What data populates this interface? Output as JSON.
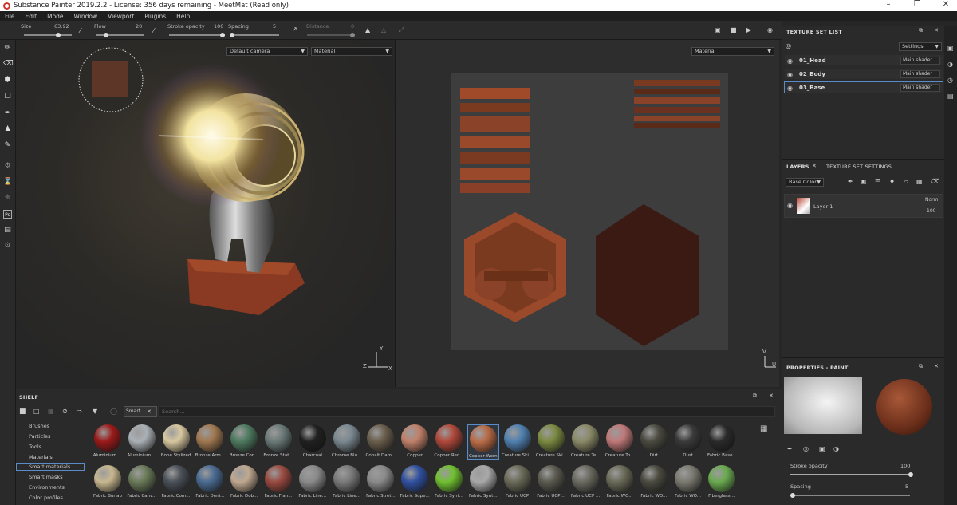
{
  "window": {
    "title": "Substance Painter 2019.2.2 - License: 356 days remaining - MeetMat (Read only)"
  },
  "menu": [
    "File",
    "Edit",
    "Mode",
    "Window",
    "Viewport",
    "Plugins",
    "Help"
  ],
  "toolbar": {
    "size_label": "Size",
    "size_value": "63.92",
    "flow_label": "Flow",
    "flow_value": "20",
    "opacity_label": "Stroke opacity",
    "opacity_value": "100",
    "spacing_label": "Spacing",
    "spacing_value": "5",
    "distance_label": "Distance",
    "distance_value": "0"
  },
  "viewport": {
    "camera": "Default camera",
    "mode3d": "Material",
    "mode2d": "Material"
  },
  "axes": {
    "y": "Y",
    "z": "Z",
    "x": "X",
    "v": "V",
    "u": "U"
  },
  "texture_set_list": {
    "title": "TEXTURE SET LIST",
    "settings": "Settings",
    "items": [
      {
        "name": "01_Head",
        "shader": "Main shader"
      },
      {
        "name": "02_Body",
        "shader": "Main shader"
      },
      {
        "name": "03_Base",
        "shader": "Main shader"
      }
    ]
  },
  "layers": {
    "tab_layers": "LAYERS",
    "tab_settings": "TEXTURE SET SETTINGS",
    "channel": "Base Color",
    "layer_name": "Layer 1",
    "blend": "Norm",
    "opacity": "100"
  },
  "properties": {
    "title": "PROPERTIES - PAINT",
    "opacity_label": "Stroke opacity",
    "opacity_value": "100",
    "spacing_label": "Spacing",
    "spacing_value": "5"
  },
  "shelf": {
    "title": "SHELF",
    "filter_tag": "Smart...",
    "search_placeholder": "Search...",
    "nav": [
      "Brushes",
      "Particles",
      "Tools",
      "Materials",
      "Smart materials",
      "Smart masks",
      "Environments",
      "Color profiles"
    ],
    "selected_nav": "Smart materials",
    "row1": [
      "Aluminium ...",
      "Aluminium ...",
      "Bone Stylized",
      "Bronze Arm...",
      "Bronze Con...",
      "Bronze Stat...",
      "Charcoal",
      "Chrome Blu...",
      "Cobalt Dam...",
      "Copper",
      "Copper Red...",
      "Copper Worn",
      "Creature Ski...",
      "Creature Ski...",
      "Creature Te...",
      "Creature To...",
      "Dirt",
      "Dust",
      "Fabric Base..."
    ],
    "row2": [
      "Fabric Burlap",
      "Fabric Canv...",
      "Fabric Com...",
      "Fabric Deni...",
      "Fabric Dob...",
      "Fabric Flan...",
      "Fabric Line...",
      "Fabric Line...",
      "Fabric Stret...",
      "Fabric Supe...",
      "Fabric Synt...",
      "Fabric Synt...",
      "Fabric UCP",
      "Fabric UCP ...",
      "Fabric UCP ...",
      "Fabric WO...",
      "Fabric WO...",
      "Fabric WO...",
      "Fiberglass ..."
    ]
  },
  "colors": {
    "row1": [
      "#9b1a1a",
      "#aab0b5",
      "#d8c8a0",
      "#a07850",
      "#4e7a60",
      "#6a7a78",
      "#202020",
      "#7a8890",
      "#6a5e4c",
      "#c0806a",
      "#b0483a",
      "#b86a45",
      "#5080b0",
      "#7a8a40",
      "#8a8a68",
      "#c07878",
      "#4a4a40",
      "#3a3a3a",
      "#2a2a2a"
    ],
    "row2": [
      "#c8b890",
      "#6a7a58",
      "#4a5058",
      "#4a6a90",
      "#c0a890",
      "#9a4a40",
      "#8a8a8a",
      "#7a7a7a",
      "#8a8a8a",
      "#3050a0",
      "#70c030",
      "#a8a8a8",
      "#6a6a58",
      "#5a5a50",
      "#6a6a60",
      "#6a6a58",
      "#4a4a40",
      "#7a7a70",
      "#6aaa50"
    ]
  }
}
